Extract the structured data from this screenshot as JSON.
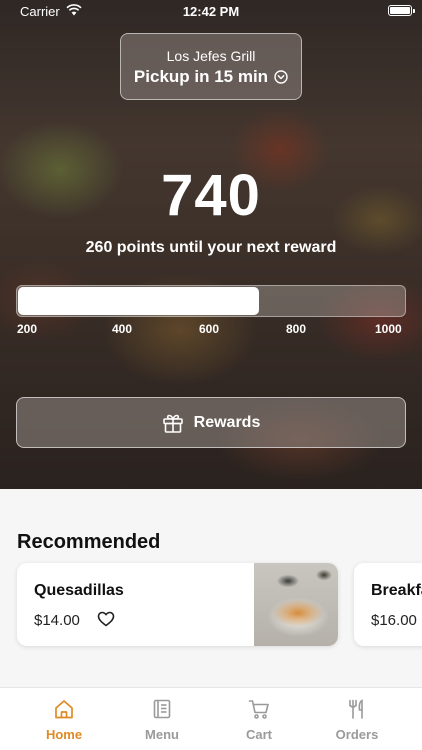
{
  "status_bar": {
    "carrier": "Carrier",
    "time": "12:42 PM"
  },
  "location": {
    "restaurant": "Los Jefes Grill",
    "pickup": "Pickup in 15 min"
  },
  "loyalty": {
    "points": "740",
    "message": "260 points until your next reward",
    "progress_fraction": 0.62,
    "ticks": [
      "200",
      "400",
      "600",
      "800",
      "1000"
    ]
  },
  "rewards_button": {
    "label": "Rewards"
  },
  "recommended": {
    "title": "Recommended",
    "items": [
      {
        "name": "Quesadillas",
        "price": "$14.00"
      },
      {
        "name": "Breakfast",
        "price": "$16.00"
      }
    ]
  },
  "tabs": [
    {
      "label": "Home",
      "icon": "home-icon",
      "active": true
    },
    {
      "label": "Menu",
      "icon": "menu-icon",
      "active": false
    },
    {
      "label": "Cart",
      "icon": "cart-icon",
      "active": false
    },
    {
      "label": "Orders",
      "icon": "orders-icon",
      "active": false
    }
  ],
  "colors": {
    "accent": "#e08a25",
    "inactive_tab": "#9a9a9a"
  }
}
